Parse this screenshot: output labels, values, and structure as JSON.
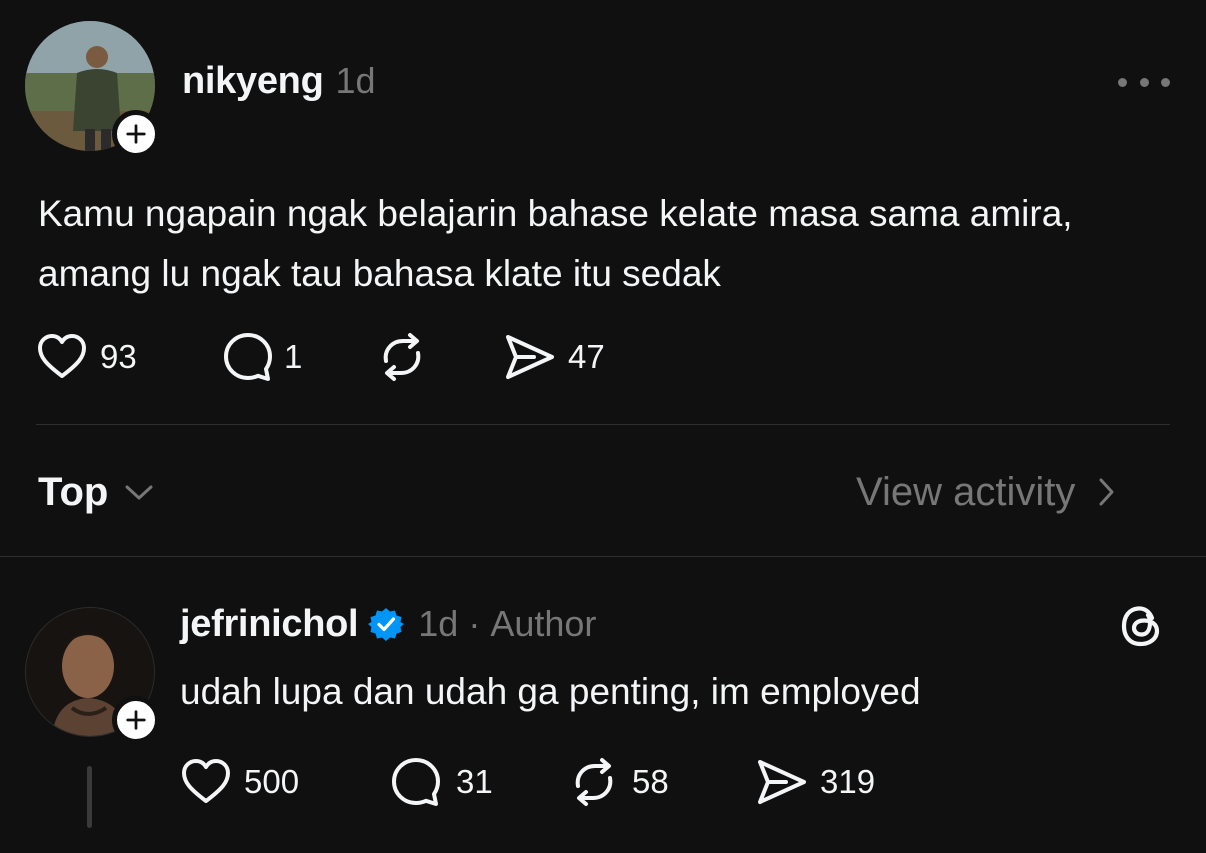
{
  "post": {
    "username": "nikyeng",
    "time": "1d",
    "text": "Kamu ngapain ngak belajarin bahase kelate masa sama amira, amang lu ngak tau bahasa klate itu sedak",
    "stats": {
      "likes": "93",
      "replies": "1",
      "reposts": "",
      "shares": "47"
    }
  },
  "sort": {
    "label": "Top",
    "view_activity_label": "View activity"
  },
  "reply": {
    "username": "jefrinichol",
    "verified": true,
    "time": "1d",
    "separator": "·",
    "author_tag": "Author",
    "text": "udah lupa dan udah ga penting, im employed",
    "stats": {
      "likes": "500",
      "replies": "31",
      "reposts": "58",
      "shares": "319"
    }
  },
  "icons": {
    "like": "heart-icon",
    "reply": "comment-icon",
    "repost": "repost-icon",
    "share": "share-icon",
    "more": "more-icon",
    "follow": "plus-icon",
    "verified": "verified-badge-icon",
    "threads": "threads-logo-icon"
  },
  "colors": {
    "background": "#101010",
    "text": "#f3f5f7",
    "muted": "#777777",
    "verified": "#0095f6"
  }
}
